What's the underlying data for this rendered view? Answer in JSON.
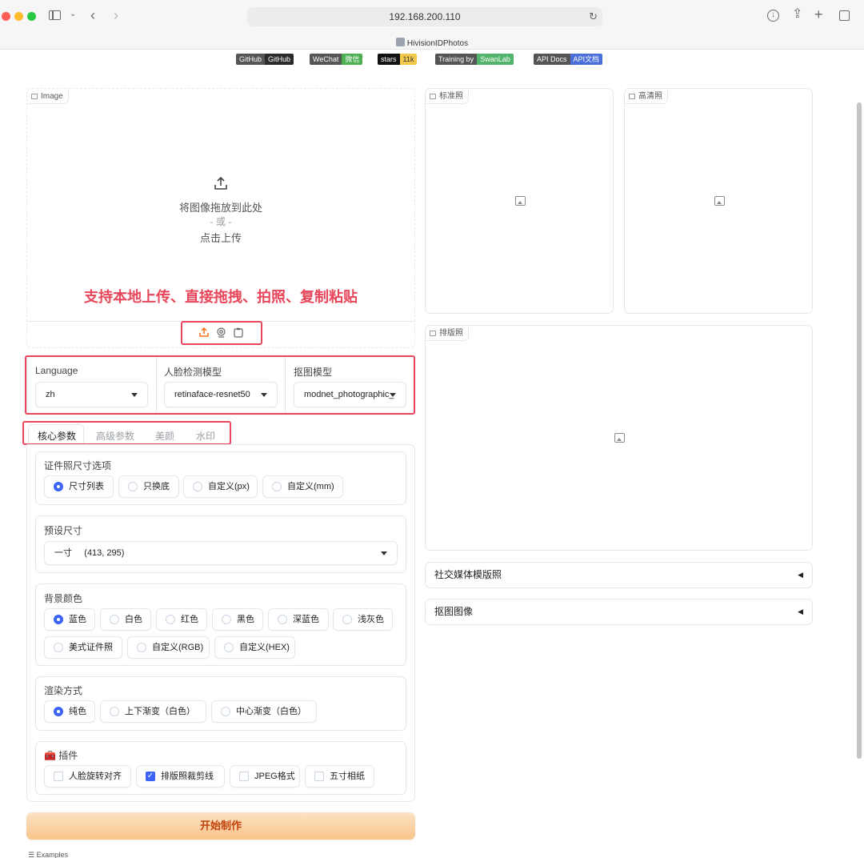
{
  "browser": {
    "url": "192.168.200.110",
    "tab_title": "HivisionIDPhotos"
  },
  "badges": [
    {
      "left": "GitHub",
      "right": "GitHub",
      "right_color": "#2b2b2b"
    },
    {
      "left": "WeChat",
      "right": "微信",
      "right_color": "#4caf50"
    },
    {
      "left": "stars",
      "right": "11k",
      "right_color": "#f2c94c"
    },
    {
      "left": "Training by",
      "right": "SwanLab",
      "right_color": "#52b36a"
    },
    {
      "left": "API Docs",
      "right": "API文档",
      "right_color": "#4a6fd8"
    }
  ],
  "upload": {
    "label": "Image",
    "drop_text": "将图像拖放到此处",
    "or_text": "- 或 -",
    "click_text": "点击上传",
    "annotation": "支持本地上传、直接拖拽、拍照、复制粘贴",
    "sources": [
      "upload-icon",
      "webcam-icon",
      "clipboard-icon"
    ]
  },
  "selects": [
    {
      "label": "Language",
      "value": "zh"
    },
    {
      "label": "人脸检测模型",
      "value": "retinaface-resnet50"
    },
    {
      "label": "抠图模型",
      "value": "modnet_photographic_"
    }
  ],
  "tabs": [
    "核心参数",
    "高级参数",
    "美颜",
    "水印"
  ],
  "active_tab": "核心参数",
  "size_options": {
    "title": "证件照尺寸选项",
    "options": [
      "尺寸列表",
      "只换底",
      "自定义(px)",
      "自定义(mm)"
    ],
    "selected": "尺寸列表"
  },
  "preset": {
    "title": "预设尺寸",
    "value": "一寸     (413, 295)"
  },
  "bg_color": {
    "title": "背景颜色",
    "options": [
      "蓝色",
      "白色",
      "红色",
      "黑色",
      "深蓝色",
      "浅灰色",
      "美式证件照",
      "自定义(RGB)",
      "自定义(HEX)"
    ],
    "selected": "蓝色"
  },
  "render": {
    "title": "渲染方式",
    "options": [
      "纯色",
      "上下渐变（白色）",
      "中心渐变（白色）"
    ],
    "selected": "纯色"
  },
  "plugins": {
    "title": "🧰 插件",
    "options": [
      "人脸旋转对齐",
      "排版照裁剪线",
      "JPEG格式",
      "五寸相纸"
    ],
    "checked": [
      false,
      true,
      false,
      false
    ]
  },
  "start_button": "开始制作",
  "examples_label": "Examples",
  "outputs": {
    "standard": "标准照",
    "hd": "高清照",
    "layout": "排版照"
  },
  "accordions": [
    "社交媒体模版照",
    "抠图图像"
  ],
  "accent_color": "#3b63f5",
  "annotation_color": "#e8465a"
}
